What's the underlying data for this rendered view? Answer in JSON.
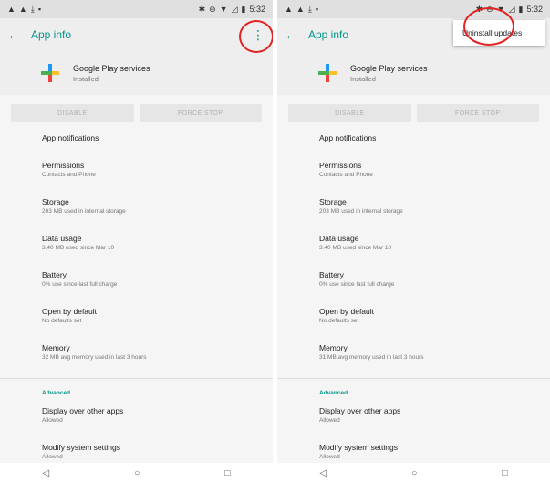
{
  "status_bar": {
    "time": "5:32"
  },
  "app_bar": {
    "title": "App info"
  },
  "app": {
    "name": "Google Play services",
    "status": "Installed"
  },
  "buttons": {
    "disable": "DISABLE",
    "force_stop": "FORCE STOP"
  },
  "left_items": [
    {
      "title": "App notifications",
      "sub": ""
    },
    {
      "title": "Permissions",
      "sub": "Contacts and Phone"
    },
    {
      "title": "Storage",
      "sub": "203 MB used in internal storage"
    },
    {
      "title": "Data usage",
      "sub": "3.40 MB used since Mar 10"
    },
    {
      "title": "Battery",
      "sub": "0% use since last full charge"
    },
    {
      "title": "Open by default",
      "sub": "No defaults set"
    },
    {
      "title": "Memory",
      "sub": "32 MB avg memory used in last 3 hours"
    }
  ],
  "right_items": [
    {
      "title": "App notifications",
      "sub": ""
    },
    {
      "title": "Permissions",
      "sub": "Contacts and Phone"
    },
    {
      "title": "Storage",
      "sub": "203 MB used in internal storage"
    },
    {
      "title": "Data usage",
      "sub": "3.40 MB used since Mar 10"
    },
    {
      "title": "Battery",
      "sub": "0% use since last full charge"
    },
    {
      "title": "Open by default",
      "sub": "No defaults set"
    },
    {
      "title": "Memory",
      "sub": "31 MB avg memory used in last 3 hours"
    }
  ],
  "advanced": {
    "header": "Advanced",
    "items": [
      {
        "title": "Display over other apps",
        "sub": "Allowed"
      },
      {
        "title": "Modify system settings",
        "sub": "Allowed"
      }
    ]
  },
  "menu": {
    "uninstall_updates": "Uninstall updates"
  },
  "icons": {
    "back": "arrow-left-icon",
    "more": "more-vert-icon",
    "nav_back": "triangle-back-icon",
    "nav_home": "circle-home-icon",
    "nav_recents": "square-recents-icon"
  },
  "colors": {
    "accent": "#009688",
    "annotation": "#e32222"
  }
}
